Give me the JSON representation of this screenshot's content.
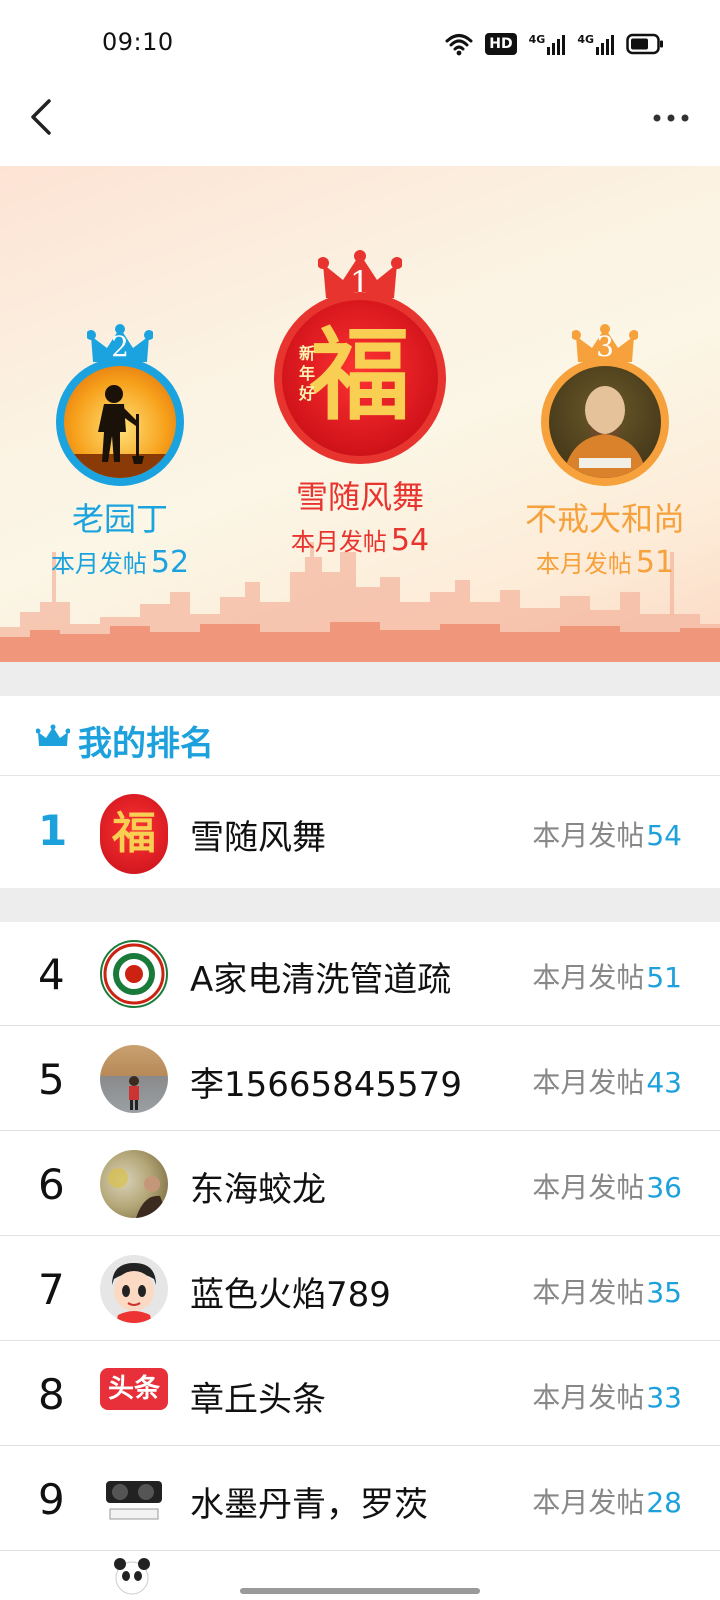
{
  "status_bar": {
    "time": "09:10",
    "hd_label": "HD",
    "net1": "4G",
    "net2": "4G",
    "icons": [
      "wifi-icon",
      "hd-icon",
      "signal-icon",
      "signal-icon",
      "battery-icon"
    ]
  },
  "nav": {
    "back_icon": "chevron-left-icon",
    "more_icon": "more-dots-icon"
  },
  "podium": {
    "first": {
      "rank": "1",
      "name": "雪随风舞",
      "posts_label": "本月发帖",
      "posts": "54",
      "avatar_text": "福",
      "avatar_sub": "新年好",
      "color": "#e8342e"
    },
    "second": {
      "rank": "2",
      "name": "老园丁",
      "posts_label": "本月发帖",
      "posts": "52",
      "color": "#1aa3de"
    },
    "third": {
      "rank": "3",
      "name": "不戒大和尚",
      "posts_label": "本月发帖",
      "posts": "51",
      "color": "#f6a13b"
    }
  },
  "my_rank": {
    "title": "我的排名",
    "rank": "1",
    "name": "雪随风舞",
    "posts_label": "本月发帖",
    "posts": "54",
    "avatar_text": "福"
  },
  "list": [
    {
      "rank": "4",
      "name": "A家电清洗管道疏",
      "posts_label": "本月发帖",
      "posts": "51"
    },
    {
      "rank": "5",
      "name": "李15665845579",
      "posts_label": "本月发帖",
      "posts": "43"
    },
    {
      "rank": "6",
      "name": "东海蛟龙",
      "posts_label": "本月发帖",
      "posts": "36"
    },
    {
      "rank": "7",
      "name": "蓝色火焰789",
      "posts_label": "本月发帖",
      "posts": "35"
    },
    {
      "rank": "8",
      "name": "章丘头条",
      "posts_label": "本月发帖",
      "posts": "33",
      "avatar_text": "头条"
    },
    {
      "rank": "9",
      "name": "水墨丹青，罗茨",
      "posts_label": "本月发帖",
      "posts": "28"
    }
  ],
  "colors": {
    "accent_blue": "#1da1dc",
    "gold_red": "#e8342e",
    "orange": "#f6a13b"
  }
}
